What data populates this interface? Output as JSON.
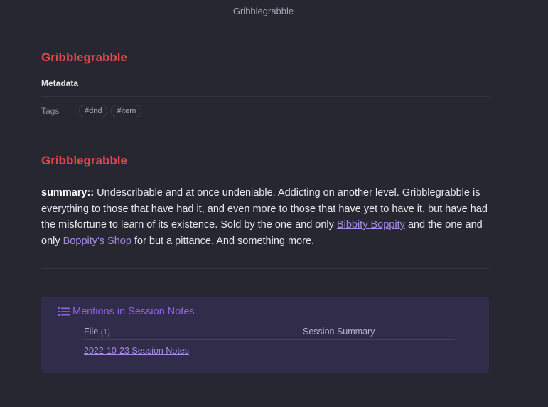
{
  "window": {
    "title": "Gribblegrabble"
  },
  "note": {
    "heading": "Gribblegrabble",
    "metadata_label": "Metadata",
    "tags_key": "Tags",
    "tags": [
      "#dnd",
      "#item"
    ],
    "second_heading": "Gribblegrabble",
    "summary": {
      "key": "summary::",
      "text_1": " Undescribable and at once undeniable. Addicting on another level. Gribblegrabble is everything to those that have had it, and even more to those that have yet to have it, but have had the misfortune to learn of its existence. Sold by the one and only ",
      "link_1": "Bibbity Boppity",
      "text_2": " and the one and only ",
      "link_2": "Boppity's Shop",
      "text_3": " for but a pittance. And something more."
    }
  },
  "mentions": {
    "title": "Mentions in Session Notes",
    "icon": "list-icon",
    "columns": {
      "file": "File",
      "file_count": "(1)",
      "summary": "Session Summary"
    },
    "rows": [
      {
        "file": "2022-10-23 Session Notes",
        "summary": ""
      }
    ]
  },
  "colors": {
    "background": "#262731",
    "heading": "#e2494c",
    "link": "#a88be6",
    "mentions_bg": "#312c4a",
    "mentions_title": "#8f63e6"
  }
}
